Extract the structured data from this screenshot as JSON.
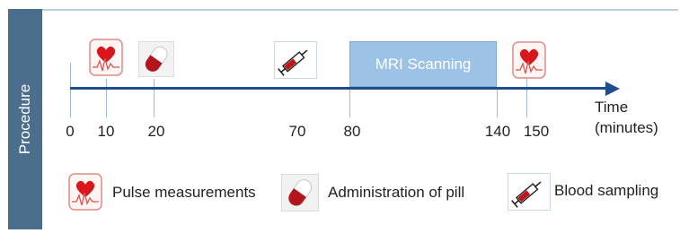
{
  "side_label": "Procedure",
  "axis": {
    "title_line1": "Time",
    "title_line2": "(minutes)",
    "ticks": [
      {
        "label": "0"
      },
      {
        "label": "10"
      },
      {
        "label": "20"
      },
      {
        "label": "70"
      },
      {
        "label": "80"
      },
      {
        "label": "140"
      },
      {
        "label": "150"
      }
    ]
  },
  "mri_label": "MRI Scanning",
  "legend": {
    "pulse": "Pulse measurements",
    "pill": "Administration of pill",
    "blood": "Blood sampling"
  },
  "icons": {
    "pulse": "heart-pulse-icon",
    "pill": "pill-capsule-icon",
    "blood": "syringe-icon"
  },
  "colors": {
    "side_bar": "#4a6e8c",
    "axis": "#1f4e8c",
    "mri_box": "#9cc3e6",
    "heart": "#d9161c",
    "pill": "#b3151c"
  }
}
